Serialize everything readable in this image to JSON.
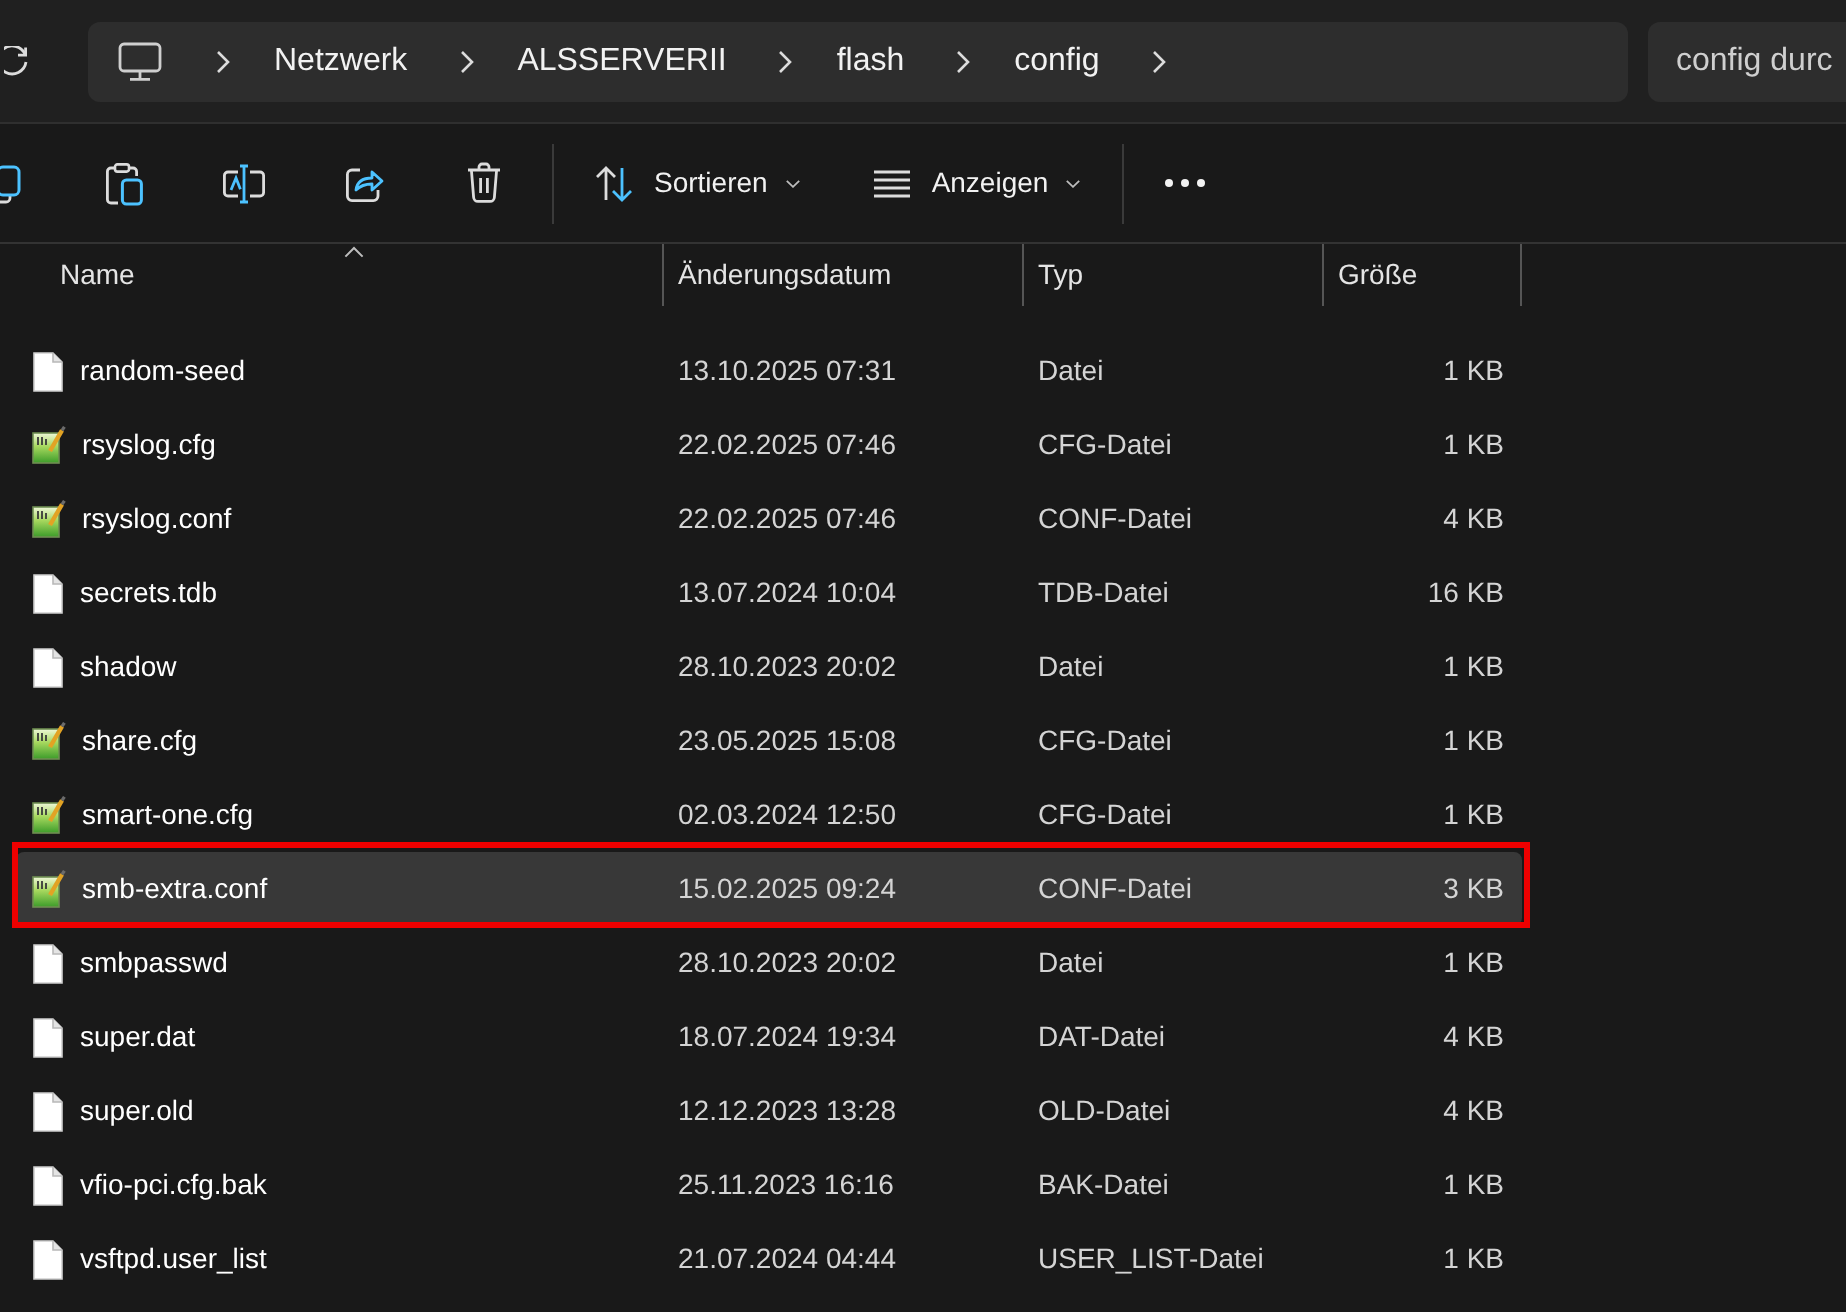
{
  "address_bar": {
    "breadcrumbs": [
      "Netzwerk",
      "ALSSERVERII",
      "flash",
      "config"
    ]
  },
  "search": {
    "placeholder": "config durc"
  },
  "toolbar": {
    "sort": {
      "label": "Sortieren"
    },
    "view": {
      "label": "Anzeigen"
    }
  },
  "columns": [
    {
      "label": "Name",
      "sorted": true
    },
    {
      "label": "Änderungsdatum",
      "sorted": false
    },
    {
      "label": "Typ",
      "sorted": false
    },
    {
      "label": "Größe",
      "sorted": false
    }
  ],
  "rows": [
    {
      "kind": "plain",
      "name": "random-seed",
      "date": "13.10.2025 07:31",
      "type": "Datei",
      "size": "1 KB",
      "selected": false,
      "highlighted": false
    },
    {
      "kind": "notepad",
      "name": "rsyslog.cfg",
      "date": "22.02.2025 07:46",
      "type": "CFG-Datei",
      "size": "1 KB",
      "selected": false,
      "highlighted": false
    },
    {
      "kind": "notepad",
      "name": "rsyslog.conf",
      "date": "22.02.2025 07:46",
      "type": "CONF-Datei",
      "size": "4 KB",
      "selected": false,
      "highlighted": false
    },
    {
      "kind": "plain",
      "name": "secrets.tdb",
      "date": "13.07.2024 10:04",
      "type": "TDB-Datei",
      "size": "16 KB",
      "selected": false,
      "highlighted": false
    },
    {
      "kind": "plain",
      "name": "shadow",
      "date": "28.10.2023 20:02",
      "type": "Datei",
      "size": "1 KB",
      "selected": false,
      "highlighted": false
    },
    {
      "kind": "notepad",
      "name": "share.cfg",
      "date": "23.05.2025 15:08",
      "type": "CFG-Datei",
      "size": "1 KB",
      "selected": false,
      "highlighted": false
    },
    {
      "kind": "notepad",
      "name": "smart-one.cfg",
      "date": "02.03.2024 12:50",
      "type": "CFG-Datei",
      "size": "1 KB",
      "selected": false,
      "highlighted": false
    },
    {
      "kind": "notepad",
      "name": "smb-extra.conf",
      "date": "15.02.2025 09:24",
      "type": "CONF-Datei",
      "size": "3 KB",
      "selected": true,
      "highlighted": true
    },
    {
      "kind": "plain",
      "name": "smbpasswd",
      "date": "28.10.2023 20:02",
      "type": "Datei",
      "size": "1 KB",
      "selected": false,
      "highlighted": false
    },
    {
      "kind": "plain",
      "name": "super.dat",
      "date": "18.07.2024 19:34",
      "type": "DAT-Datei",
      "size": "4 KB",
      "selected": false,
      "highlighted": false
    },
    {
      "kind": "plain",
      "name": "super.old",
      "date": "12.12.2023 13:28",
      "type": "OLD-Datei",
      "size": "4 KB",
      "selected": false,
      "highlighted": false
    },
    {
      "kind": "plain",
      "name": "vfio-pci.cfg.bak",
      "date": "25.11.2023 16:16",
      "type": "BAK-Datei",
      "size": "1 KB",
      "selected": false,
      "highlighted": false
    },
    {
      "kind": "plain",
      "name": "vsftpd.user_list",
      "date": "21.07.2024 04:44",
      "type": "USER_LIST-Datei",
      "size": "1 KB",
      "selected": false,
      "highlighted": false
    }
  ]
}
